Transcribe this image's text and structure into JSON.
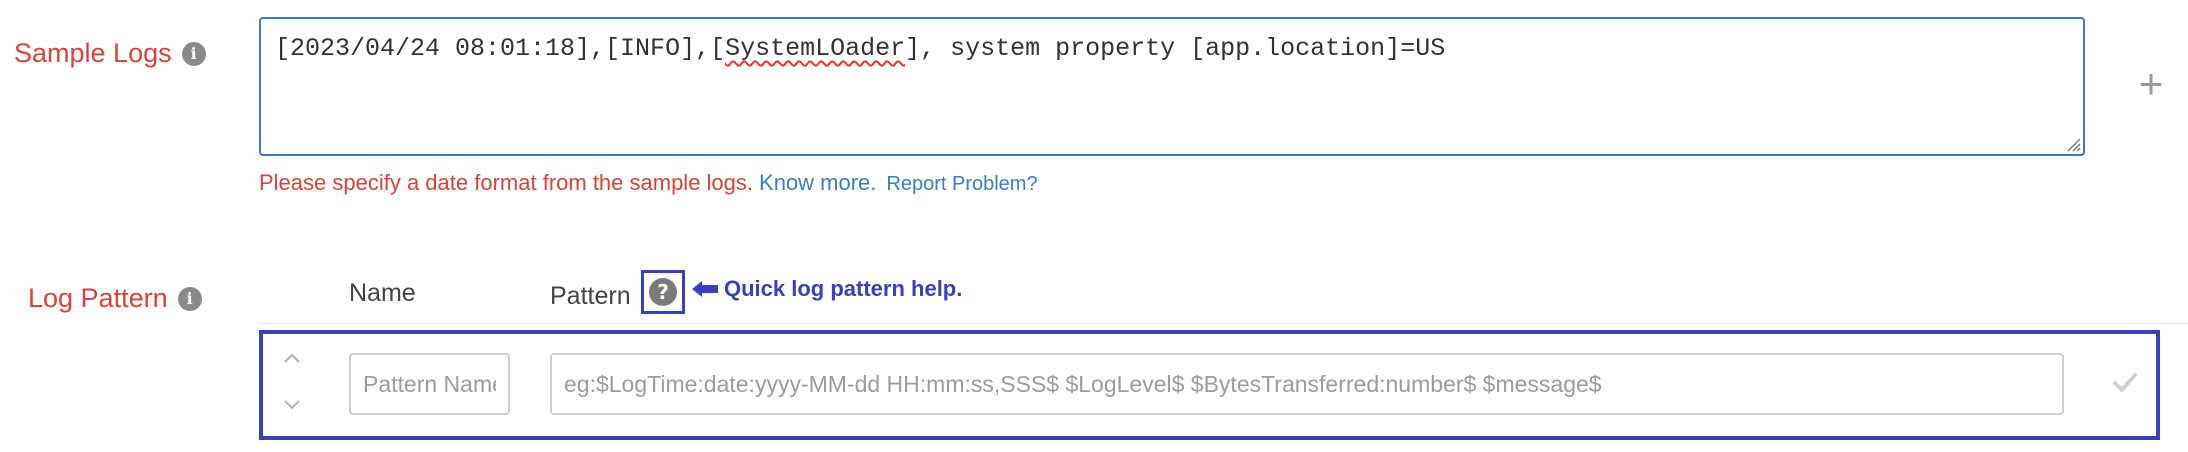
{
  "sample_logs": {
    "label": "Sample Logs",
    "info_icon": "info-icon",
    "value_prefix": "[2023/04/24 08:01:18],[INFO],[",
    "value_typo": "SystemLOader",
    "value_suffix": "], system property [app.location]=US",
    "add_icon": "plus-icon"
  },
  "error": {
    "message": "Please specify a date format from the sample logs.",
    "know_more": "Know more.",
    "report_problem": "Report Problem?"
  },
  "log_pattern": {
    "label": "Log Pattern",
    "info_icon": "info-icon",
    "columns": {
      "name": "Name",
      "pattern": "Pattern"
    },
    "help_icon_glyph": "?",
    "help_callout": "Quick log pattern help.",
    "row": {
      "name_placeholder": "Pattern Name",
      "pattern_placeholder": "eg:$LogTime:date:yyyy-MM-dd HH:mm:ss,SSS$ $LogLevel$ $BytesTransferred:number$ $message$"
    }
  },
  "colors": {
    "error": "#d9433b",
    "link": "#3b7dc4",
    "annotation": "#3a3fbf",
    "focus_border": "#3f78c2"
  }
}
